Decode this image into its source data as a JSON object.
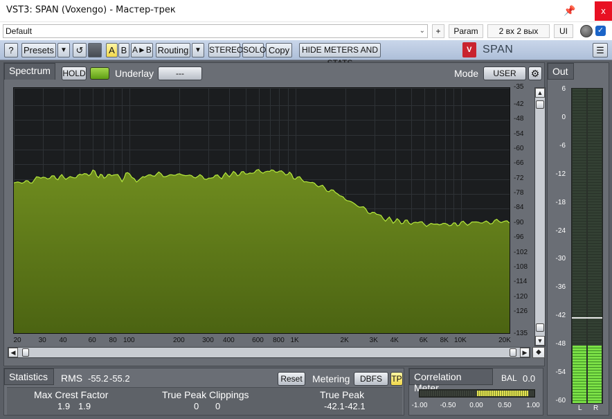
{
  "window": {
    "title": "VST3: SPAN (Voxengo) - Мастер-трек",
    "pin_glyph": "📌",
    "close_glyph": "x"
  },
  "host": {
    "preset_value": "Default",
    "plus_label": "+",
    "param_label": "Param",
    "io_label": "2 вх 2 вых",
    "ui_label": "UI",
    "bypass_checked": true
  },
  "toolbar": {
    "help": "?",
    "presets": "Presets",
    "dropdown": "▼",
    "undo": "↺",
    "a": "A",
    "b": "B",
    "ab": "A►B",
    "routing": "Routing",
    "stereo": "STEREO",
    "solo": "SOLO",
    "copy": "Copy",
    "hide": "HIDE METERS AND STATS",
    "brand": "SPAN",
    "brand_logo": "V",
    "menu": "☰"
  },
  "spectrum": {
    "tab": "Spectrum",
    "hold": "HOLD",
    "underlay_label": "Underlay",
    "underlay_value": "---",
    "mode_label": "Mode",
    "mode_value": "USER",
    "settings_glyph": "⚙",
    "y_labels": [
      "-35",
      "-42",
      "-48",
      "-54",
      "-60",
      "-66",
      "-72",
      "-78",
      "-84",
      "-90",
      "-96",
      "-102",
      "-108",
      "-114",
      "-120",
      "-126",
      "-135"
    ],
    "x_labels": [
      "20",
      "30",
      "40",
      "60",
      "80",
      "100",
      "200",
      "300",
      "400",
      "600",
      "800",
      "1K",
      "2K",
      "3K",
      "4K",
      "6K",
      "8K",
      "10K",
      "20K"
    ]
  },
  "out": {
    "tab": "Out",
    "scale": [
      "6",
      "0",
      "-6",
      "-12",
      "-18",
      "-24",
      "-30",
      "-36",
      "-42",
      "-48",
      "-54",
      "-60"
    ],
    "left_label": "L",
    "right_label": "R",
    "level_db_left": -48,
    "level_db_right": -48,
    "peak_db": -42
  },
  "statistics": {
    "tab": "Statistics",
    "rms_label": "RMS",
    "rms_l": "-55.2",
    "rms_r": "-55.2",
    "reset": "Reset",
    "metering_label": "Metering",
    "metering_value": "DBFS",
    "tp_label": "TP",
    "max_crest_label": "Max Crest Factor",
    "max_crest_l": "1.9",
    "max_crest_r": "1.9",
    "tp_clip_label": "True Peak Clippings",
    "tp_clip_l": "0",
    "tp_clip_r": "0",
    "true_peak_label": "True Peak",
    "true_peak_l": "-42.1",
    "true_peak_r": "-42.1"
  },
  "correlation": {
    "tab": "Correlation Meter",
    "bal_label": "BAL",
    "bal_value": "0.0",
    "scale": [
      "-1.00",
      "-0.50",
      "0.00",
      "0.50",
      "1.00"
    ],
    "value": 0.9
  },
  "chart_data": {
    "type": "area",
    "xscale": "log",
    "xlim": [
      20,
      20000
    ],
    "ylim": [
      -135,
      -35
    ],
    "ylabel": "",
    "xlabel": "",
    "series": [
      {
        "x": [
          20,
          25,
          30,
          35,
          40,
          45,
          50,
          55,
          60,
          65,
          70,
          80,
          90,
          100,
          110,
          120,
          130,
          150,
          170,
          200,
          250,
          300,
          350,
          400,
          500,
          600,
          700,
          800,
          900,
          1000,
          1200,
          1500,
          1800,
          2000,
          2500,
          3000,
          3500,
          4000,
          5000,
          6000,
          7000,
          8000,
          9000,
          10000,
          12000,
          15000,
          18000,
          20000
        ],
        "values": [
          -73.5,
          -73.0,
          -71.0,
          -71.5,
          -71.0,
          -71.5,
          -70.5,
          -70.0,
          -69.0,
          -70.5,
          -71.0,
          -70.0,
          -72.0,
          -69.0,
          -73.5,
          -71.0,
          -70.5,
          -70.0,
          -70.5,
          -70.0,
          -71.0,
          -71.5,
          -71.0,
          -70.0,
          -69.5,
          -69.0,
          -68.5,
          -69.0,
          -69.5,
          -71.5,
          -73.0,
          -75.5,
          -78.0,
          -80.0,
          -83.5,
          -86.0,
          -88.0,
          -89.0,
          -89.5,
          -90.0,
          -90.5,
          -90.0,
          -90.5,
          -90.0,
          -89.5,
          -89.5,
          -89.0,
          -89.5
        ]
      }
    ]
  }
}
